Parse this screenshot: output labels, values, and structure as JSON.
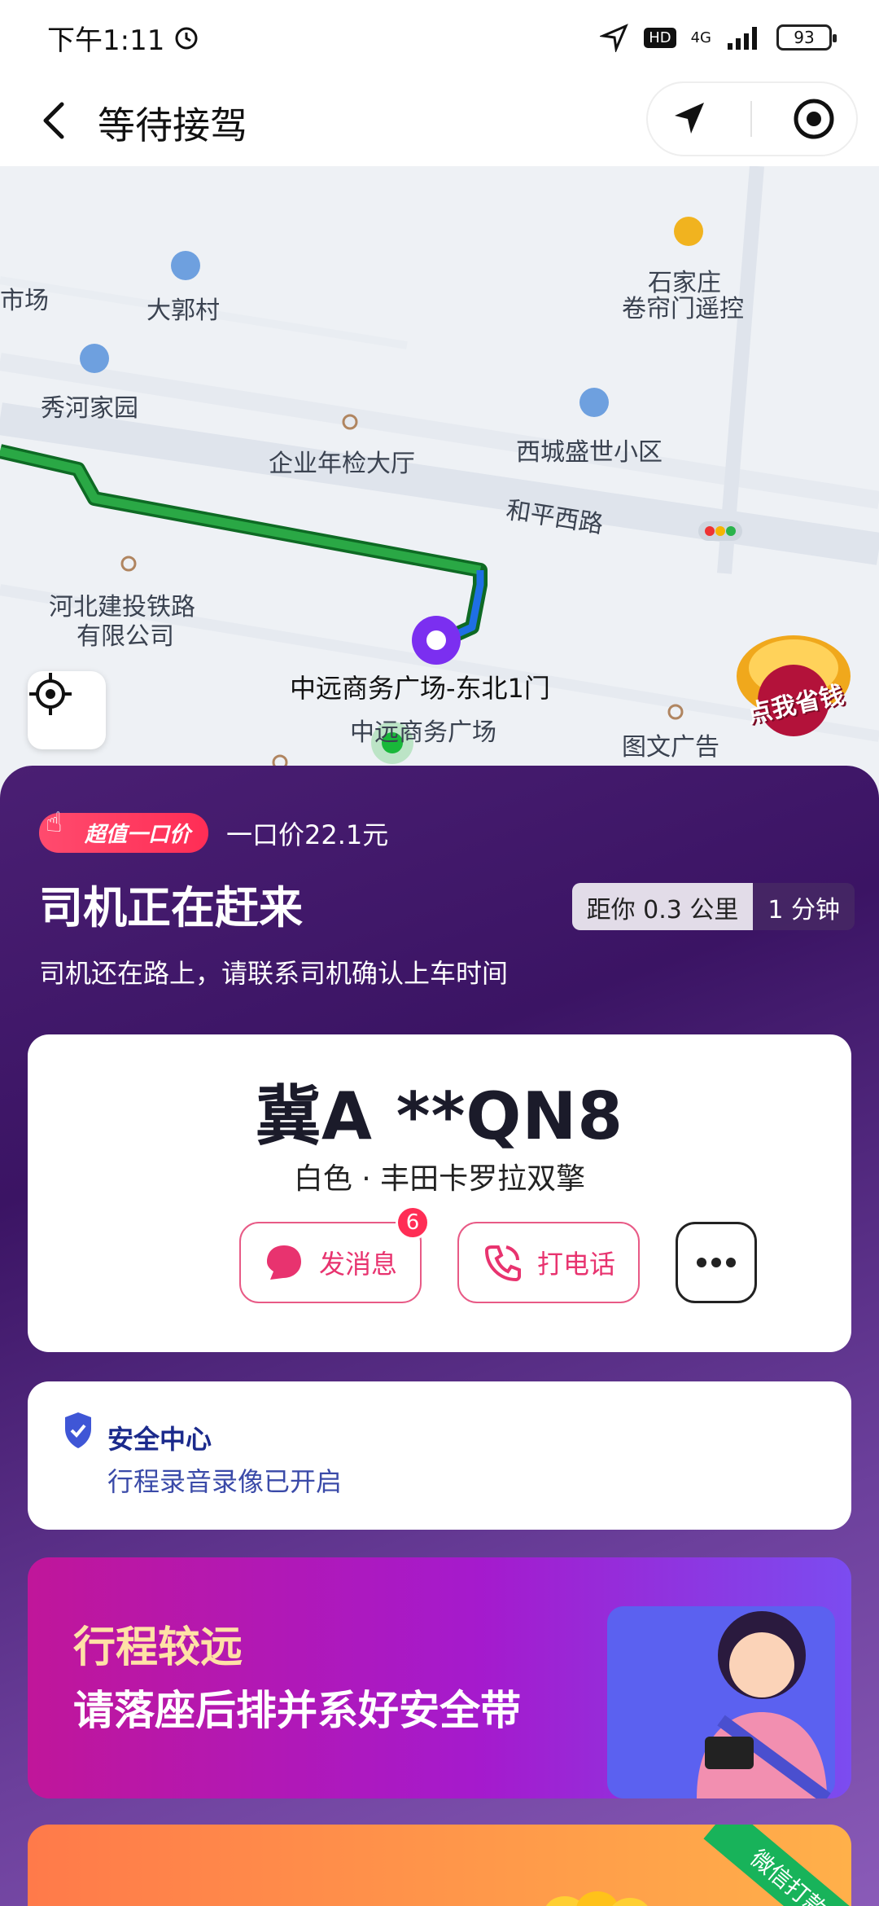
{
  "status_bar": {
    "time": "下午1:11",
    "battery": "93",
    "network": "4G",
    "hd": "HD"
  },
  "nav": {
    "title": "等待接驾"
  },
  "map": {
    "labels": [
      "市场",
      "大郭村",
      "石家庄",
      "卷帘门遥控",
      "秀河家园",
      "西城盛世小区",
      "企业年检大厅",
      "和平西路",
      "河北建投铁路",
      "有限公司",
      "中远商务广场-东北1门",
      "中远商务广场",
      "图文广告"
    ],
    "promo_badge": "点我省钱"
  },
  "trip": {
    "price_tag": "超值一口价",
    "price_text": "一口价22.1元",
    "status_title": "司机正在赶来",
    "status_subtitle": "司机还在路上，请联系司机确认上车时间",
    "distance": "距你 0.3 公里",
    "eta": "1 分钟"
  },
  "car": {
    "plate": "冀A **QN8",
    "description": "白色 · 丰田卡罗拉双擎",
    "message_label": "发消息",
    "message_badge": "6",
    "call_label": "打电话"
  },
  "safety": {
    "title": "安全中心",
    "subtitle": "行程录音录像已开启"
  },
  "banner": {
    "line1": "行程较远",
    "line2": "请落座后排并系好安全带"
  },
  "promo": {
    "tag": "微信打款"
  },
  "colors": {
    "accent_pink": "#e8336f",
    "route_green": "#1f9d3a",
    "sheet_purple": "#4a1f73",
    "safety_blue": "#1b2a8c"
  }
}
